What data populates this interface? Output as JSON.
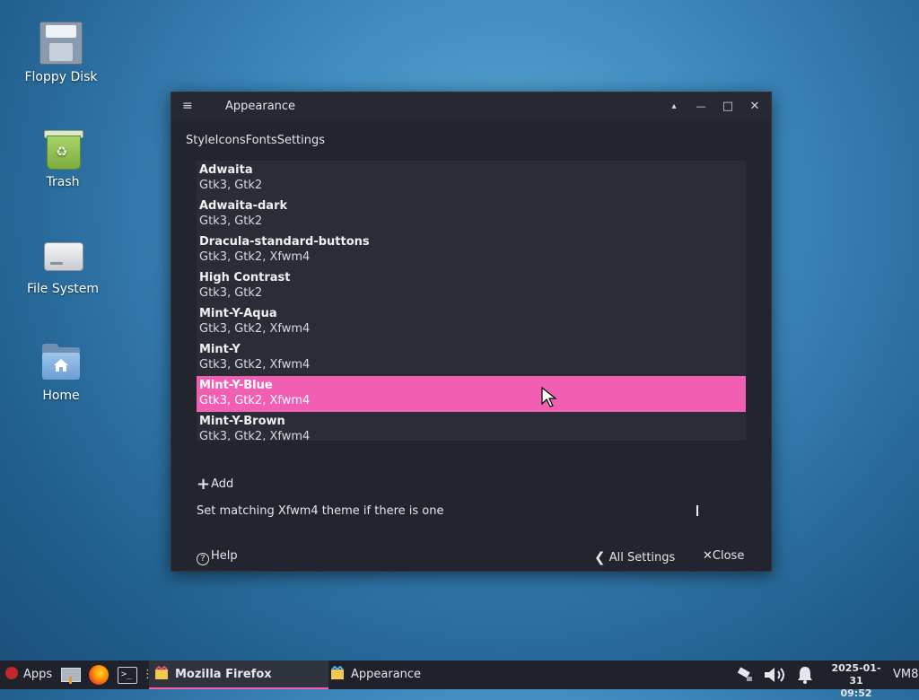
{
  "desktop": {
    "icons": [
      {
        "label": "Floppy Disk"
      },
      {
        "label": "Trash"
      },
      {
        "label": "File System"
      },
      {
        "label": "Home"
      }
    ]
  },
  "window": {
    "title": "Appearance",
    "menu_glyph": "≡",
    "controls": {
      "shade": "▴",
      "minimize": "—",
      "maximize": "□",
      "close": "✕"
    },
    "tabs": [
      "Style",
      "Icons",
      "Fonts",
      "Settings"
    ],
    "themes": [
      {
        "name": "Adwaita",
        "support": "Gtk3, Gtk2"
      },
      {
        "name": "Adwaita-dark",
        "support": "Gtk3, Gtk2"
      },
      {
        "name": "Dracula-standard-buttons",
        "support": "Gtk3, Gtk2, Xfwm4"
      },
      {
        "name": "High Contrast",
        "support": "Gtk3, Gtk2"
      },
      {
        "name": "Mint-Y-Aqua",
        "support": "Gtk3, Gtk2, Xfwm4"
      },
      {
        "name": "Mint-Y",
        "support": "Gtk3, Gtk2, Xfwm4"
      },
      {
        "name": "Mint-Y-Blue",
        "support": "Gtk3, Gtk2, Xfwm4",
        "selected": true
      },
      {
        "name": "Mint-Y-Brown",
        "support": "Gtk3, Gtk2, Xfwm4"
      }
    ],
    "add_label": "Add",
    "add_icon": "+",
    "matching_label": "Set matching Xfwm4 theme if there is one",
    "help_label": "Help",
    "all_settings_label": "All Settings",
    "close_label": "Close",
    "accent_color": "#f25fb2"
  },
  "taskbar": {
    "apps_label": "Apps",
    "windows": [
      {
        "label": "Mozilla Firefox",
        "active": true
      },
      {
        "label": "Appearance",
        "active": false
      }
    ],
    "clock": {
      "date": "2025-01-31",
      "time": "09:52"
    },
    "host_label": "VM8"
  }
}
